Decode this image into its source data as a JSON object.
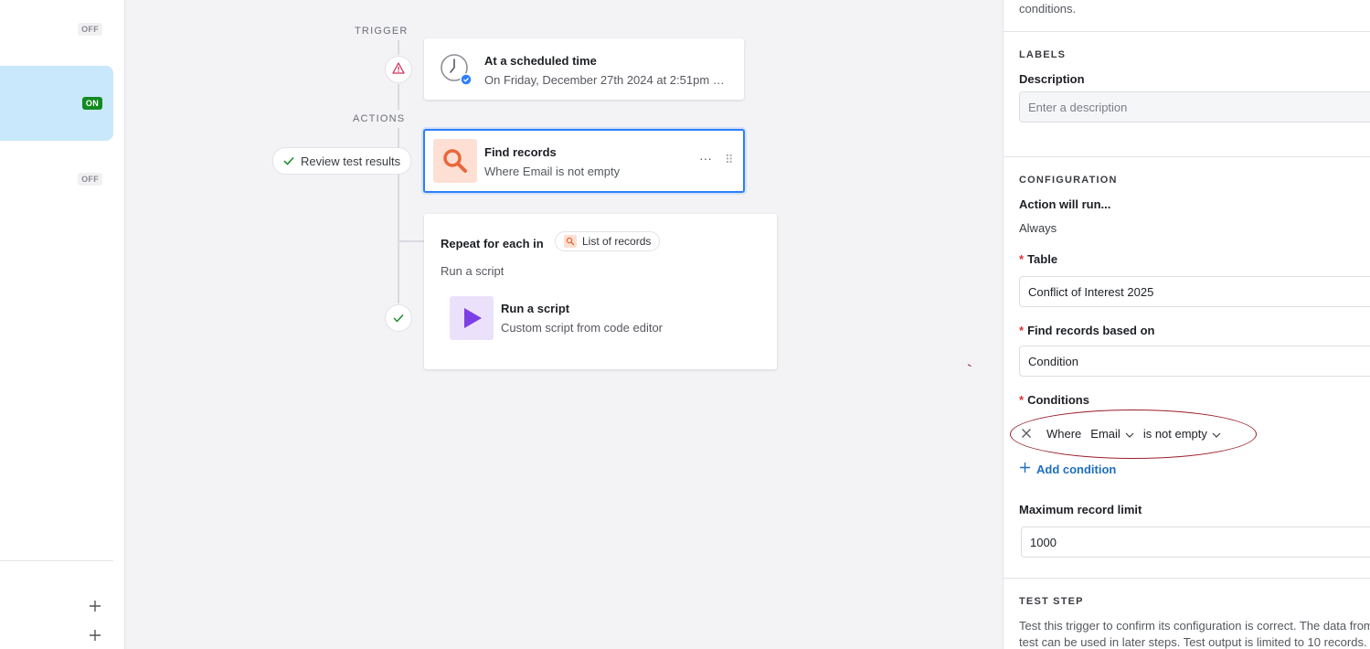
{
  "sidebar": {
    "badges": [
      "OFF",
      "ON",
      "OFF"
    ]
  },
  "flow": {
    "trigger_label": "TRIGGER",
    "actions_label": "ACTIONS",
    "trigger_card": {
      "title": "At a scheduled time",
      "subtitle": "On Friday, December 27th 2024 at 2:51pm G..."
    },
    "find_card": {
      "title": "Find records",
      "subtitle": "Where Email is not empty",
      "more": "···",
      "drag": "⠿"
    },
    "review_pill": "Review test results",
    "repeat_card": {
      "heading": "Repeat for each in",
      "chip_label": "List of records",
      "subheading": "Run a script",
      "inner_title": "Run a script",
      "inner_subtitle": "Custom script from code editor"
    }
  },
  "panel": {
    "top_text": "conditions.",
    "labels_caption": "LABELS",
    "description_label": "Description",
    "description_placeholder": "Enter a description",
    "config_caption": "CONFIGURATION",
    "run_label": "Action will run...",
    "run_value": "Always",
    "table_label": "Table",
    "table_value": "Conflict of Interest 2025",
    "find_based_label": "Find records based on",
    "find_based_value": "Condition",
    "conditions_label": "Conditions",
    "condition": {
      "where": "Where",
      "field": "Email",
      "operator": "is not empty"
    },
    "add_condition": "Add condition",
    "max_label": "Maximum record limit",
    "max_value": "1000",
    "test_caption": "TEST STEP",
    "test_text_1": "Test this trigger to confirm its configuration is correct. The data from",
    "test_text_2": "test can be used in later steps. Test output is limited to 10 records."
  },
  "colors": {
    "accent": "#2d7ff9",
    "on_badge": "#138a21",
    "active_item": "#c9e8fb",
    "link": "#1d6fbf",
    "annotation_oval": "#9a1d2a"
  }
}
